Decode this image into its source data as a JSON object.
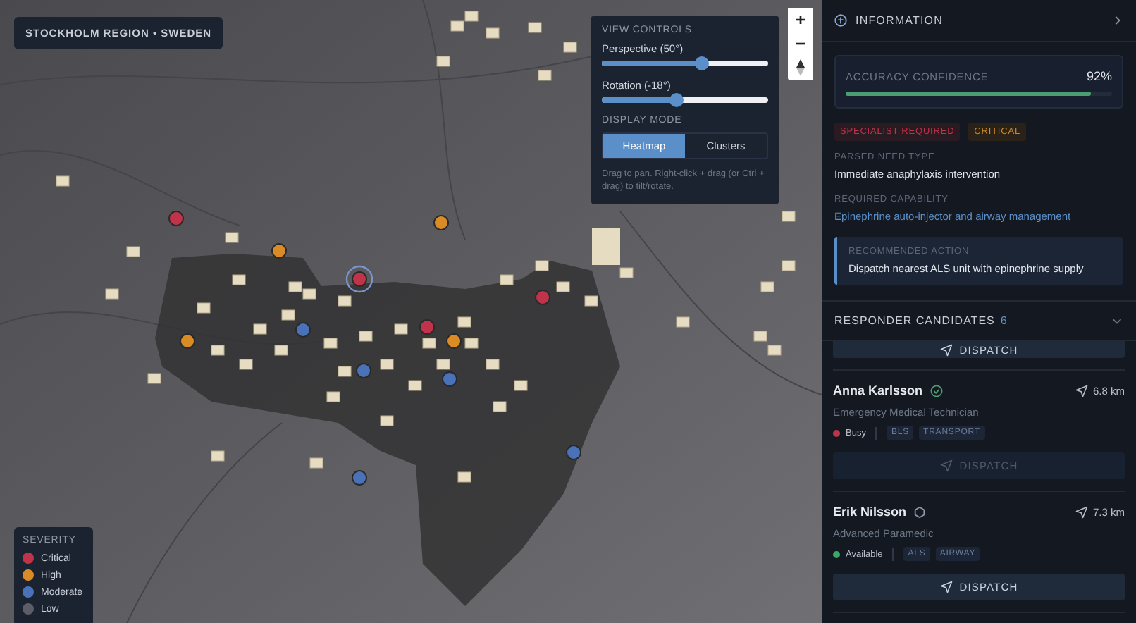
{
  "map": {
    "region_label": "STOCKHOLM REGION • SWEDEN",
    "zoom_in": "+",
    "zoom_out": "−"
  },
  "view_controls": {
    "title": "VIEW CONTROLS",
    "sliders": [
      {
        "label": "Perspective (50°)",
        "level": 0.6
      },
      {
        "label": "Rotation (-18°)",
        "level": 0.45
      }
    ],
    "display_mode_title": "DISPLAY MODE",
    "modes": [
      {
        "label": "Heatmap",
        "selected": true
      },
      {
        "label": "Clusters",
        "selected": false
      }
    ],
    "hint": "Drag to pan. Right-click + drag (or Ctrl + drag) to tilt/rotate."
  },
  "legend": {
    "title": "SEVERITY",
    "items": [
      {
        "label": "Critical",
        "color": "#c0334a"
      },
      {
        "label": "High",
        "color": "#d98c26"
      },
      {
        "label": "Moderate",
        "color": "#4a72b8"
      },
      {
        "label": "Low",
        "color": "#5e5c68"
      }
    ]
  },
  "panel": {
    "title": "INFORMATION",
    "accuracy": {
      "label": "ACCURACY CONFIDENCE",
      "value": "92%",
      "level": 0.92
    },
    "badges": [
      {
        "label": "SPECIALIST REQUIRED",
        "kind": "danger"
      },
      {
        "label": "CRITICAL",
        "kind": "warning"
      }
    ],
    "fields": [
      {
        "label": "PARSED NEED TYPE",
        "value": "Immediate anaphylaxis intervention",
        "kind": "plain"
      },
      {
        "label": "REQUIRED CAPABILITY",
        "value": "Epinephrine auto-injector and airway management",
        "kind": "link"
      }
    ],
    "recommended": {
      "label": "RECOMMENDED ACTION",
      "value": "Dispatch nearest ALS unit with epinephrine supply"
    },
    "candidates_title": "RESPONDER CANDIDATES",
    "candidates_count": "6",
    "candidates": [
      {
        "kind": "partial",
        "dispatch": "DISPATCH",
        "disabled": false
      },
      {
        "kind": "full",
        "name": "Anna Karlsson",
        "verified": true,
        "distance": "6.8 km",
        "role": "Emergency Medical Technician",
        "status": "Busy",
        "color": "#c0334a",
        "tags": [
          "BLS",
          "TRANSPORT"
        ],
        "dispatch": "DISPATCH",
        "disabled": true
      },
      {
        "kind": "full",
        "name": "Erik Nilsson",
        "verified": false,
        "distance": "7.3 km",
        "role": "Advanced Paramedic",
        "status": "Available",
        "color": "#3fa66a",
        "tags": [
          "ALS",
          "AIRWAY"
        ],
        "dispatch": "DISPATCH",
        "disabled": false
      }
    ]
  }
}
